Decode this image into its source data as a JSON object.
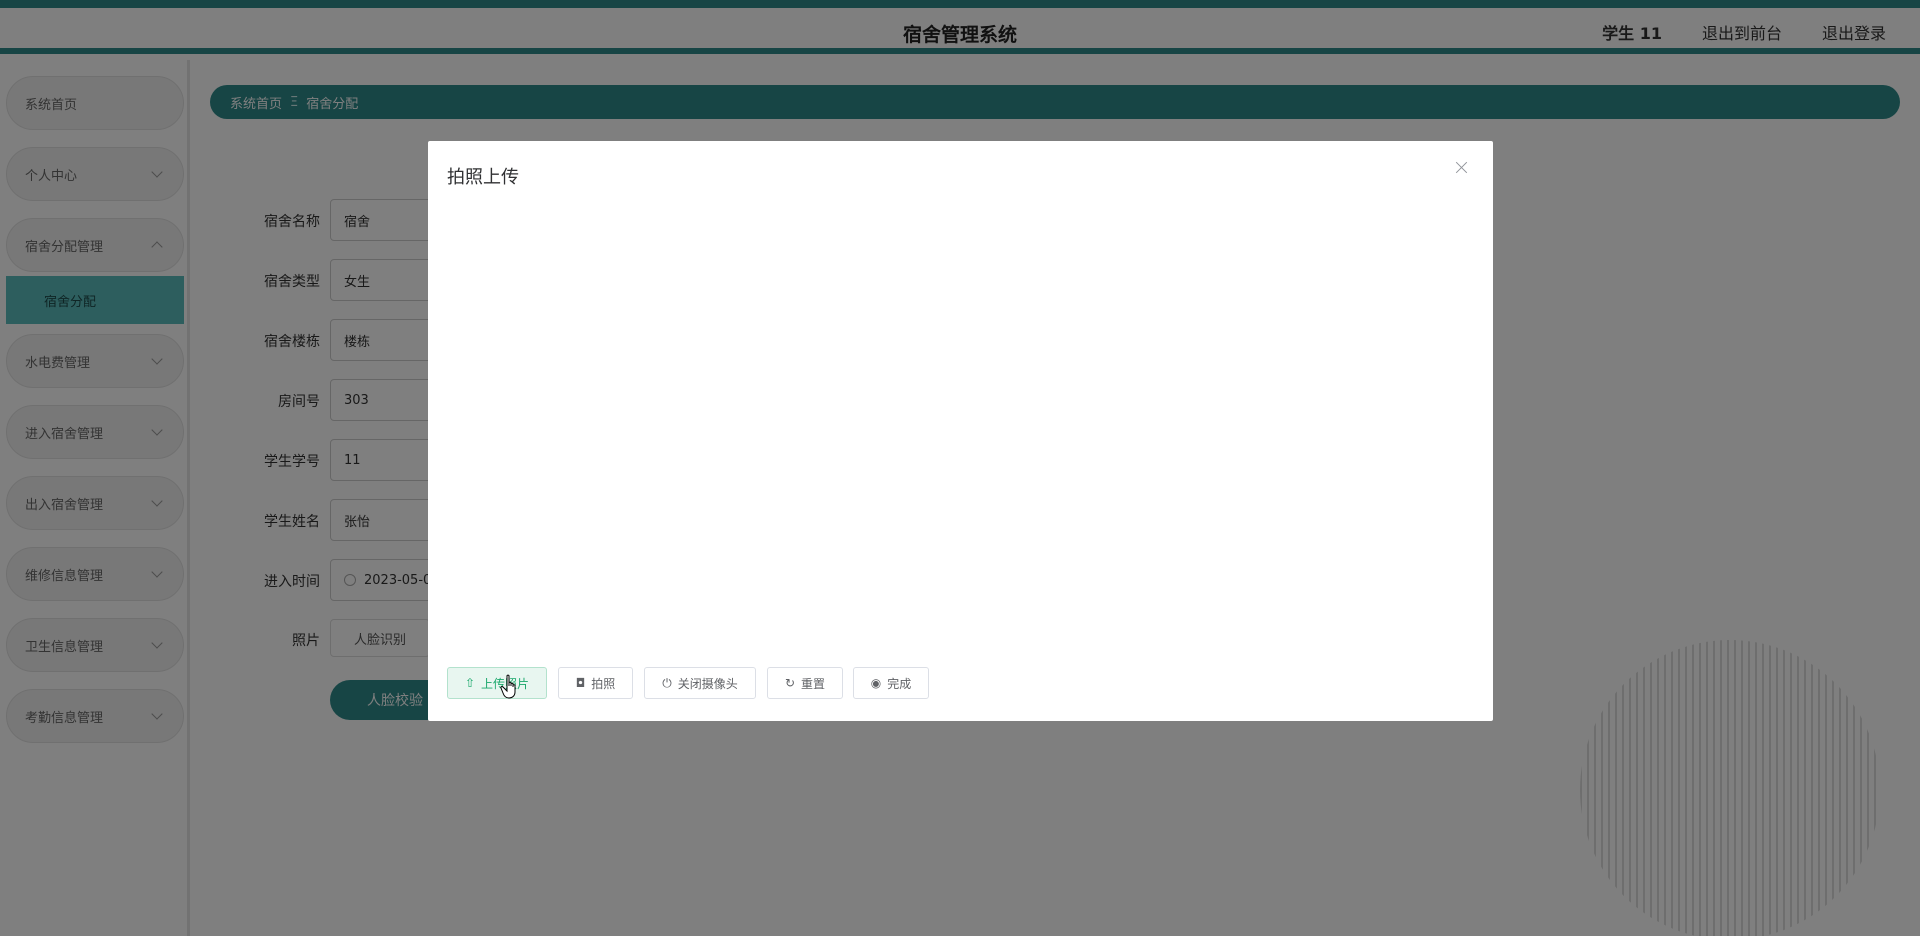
{
  "header": {
    "title": "宿舍管理系统",
    "user": "学生 11",
    "back_to_front": "退出到前台",
    "logout": "退出登录"
  },
  "sidebar": {
    "items": [
      {
        "label": "系统首页"
      },
      {
        "label": "个人中心"
      },
      {
        "label": "宿舍分配管理"
      },
      {
        "label": "宿舍分配"
      },
      {
        "label": "水电费管理"
      },
      {
        "label": "进入宿舍管理"
      },
      {
        "label": "出入宿舍管理"
      },
      {
        "label": "维修信息管理"
      },
      {
        "label": "卫生信息管理"
      },
      {
        "label": "考勤信息管理"
      }
    ]
  },
  "breadcrumb": {
    "home": "系统首页",
    "separator": "Ξ",
    "current": "宿舍分配"
  },
  "form": {
    "dorm_name_label": "宿舍名称",
    "dorm_name_value": "宿舍",
    "dorm_type_label": "宿舍类型",
    "dorm_type_value": "女生",
    "building_label": "宿舍楼栋",
    "building_value": "楼栋",
    "room_label": "房间号",
    "room_value": "303",
    "student_id_label": "学生学号",
    "student_id_value": "11",
    "student_name_label": "学生姓名",
    "student_name_value": "张怡",
    "entry_time_label": "进入时间",
    "entry_time_value": "2023-05-0",
    "photo_label": "照片",
    "face_recognition_btn": "人脸识别",
    "face_check_btn": "人脸校验"
  },
  "modal": {
    "title": "拍照上传",
    "upload_btn": "上传照片",
    "photo_btn": "拍照",
    "close_camera_btn": "关闭摄像头",
    "reset_btn": "重置",
    "done_btn": "完成"
  },
  "colors": {
    "accent": "#2e8b8b",
    "submenu_active": "#5bbdbd",
    "primary_btn": "#1aa86b"
  }
}
